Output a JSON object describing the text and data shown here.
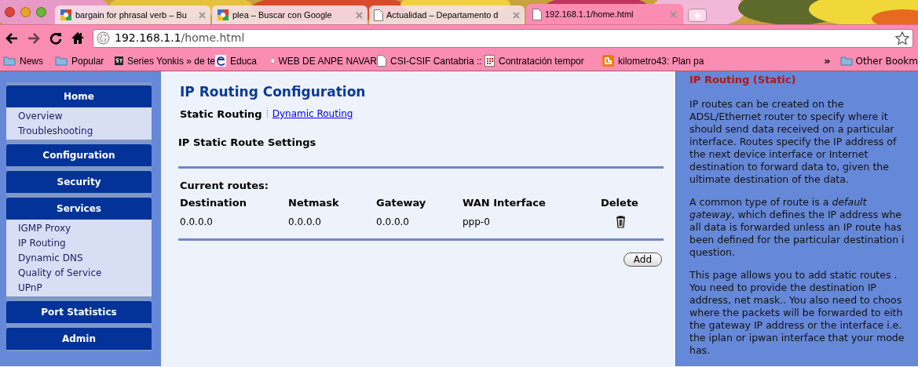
{
  "browser": {
    "tabs": [
      {
        "title": "bargain for phrasal verb – Bu",
        "selected": false
      },
      {
        "title": "plea – Buscar con Google",
        "selected": false
      },
      {
        "title": "Actualidad – Departamento d",
        "selected": false
      },
      {
        "title": "192.168.1.1/home.html",
        "selected": true
      }
    ],
    "address": {
      "host": "192.168.1.1",
      "path": "/home.html"
    },
    "bookmarks": [
      {
        "label": "News"
      },
      {
        "label": "Popular"
      },
      {
        "label": "Series Yonkis » de te"
      },
      {
        "label": "Educa"
      },
      {
        "label": "WEB DE ANPE NAVAR"
      },
      {
        "label": "CSI-CSIF Cantabria ::"
      },
      {
        "label": "Contratación tempor"
      },
      {
        "label": "kilometro43: Plan pa"
      }
    ],
    "overflow": "»",
    "other_bookmarks": "Other Bookm"
  },
  "sidebar": [
    {
      "title": "Home",
      "items": [
        {
          "label": "Overview"
        },
        {
          "label": "Troubleshooting"
        }
      ]
    },
    {
      "title": "Configuration"
    },
    {
      "title": "Security"
    },
    {
      "title": "Services",
      "items": [
        {
          "label": "IGMP Proxy"
        },
        {
          "label": "IP Routing"
        },
        {
          "label": "Dynamic DNS"
        },
        {
          "label": "Quality of Service"
        },
        {
          "label": "UPnP"
        }
      ]
    },
    {
      "title": "Port Statistics"
    },
    {
      "title": "Admin"
    }
  ],
  "main": {
    "title": "IP Routing Configuration",
    "subnav": [
      {
        "label": "Static Routing",
        "selected": true
      },
      {
        "label": "Dynamic Routing",
        "selected": false
      }
    ],
    "section": "IP Static Route Settings",
    "table_caption": "Current routes:",
    "table": {
      "columns": [
        "Destination",
        "Netmask",
        "Gateway",
        "WAN Interface",
        "Delete"
      ],
      "rows": [
        {
          "cells": [
            "0.0.0.0",
            "0.0.0.0",
            "0.0.0.0",
            "ppp-0"
          ]
        }
      ]
    },
    "add_button": "Add"
  },
  "help": {
    "title": "IP Routing (Static)",
    "paragraphs": [
      [
        "IP routes can be created on the",
        "ADSL/Ethernet router to specify where it",
        "should send data received on a particular",
        "interface. Routes specify the IP address of",
        "the next device interface or Internet",
        "destination to forward data to, given the",
        "ultimate destination of the data."
      ],
      [
        "A common type of route is a *default*",
        "*gateway*, which defines the IP address whe",
        "all data is forwarded unless an IP route has",
        "been defined for the particular destination i",
        "question."
      ],
      [
        "This page allows you to add static routes .",
        "You need to provide the destination IP",
        "address, net mask.. You also need to choos",
        "where the packets will be forwarded to eith",
        "the gateway IP address or the interface i.e.",
        "the iplan or ipwan interface that your mode",
        "has."
      ]
    ]
  }
}
